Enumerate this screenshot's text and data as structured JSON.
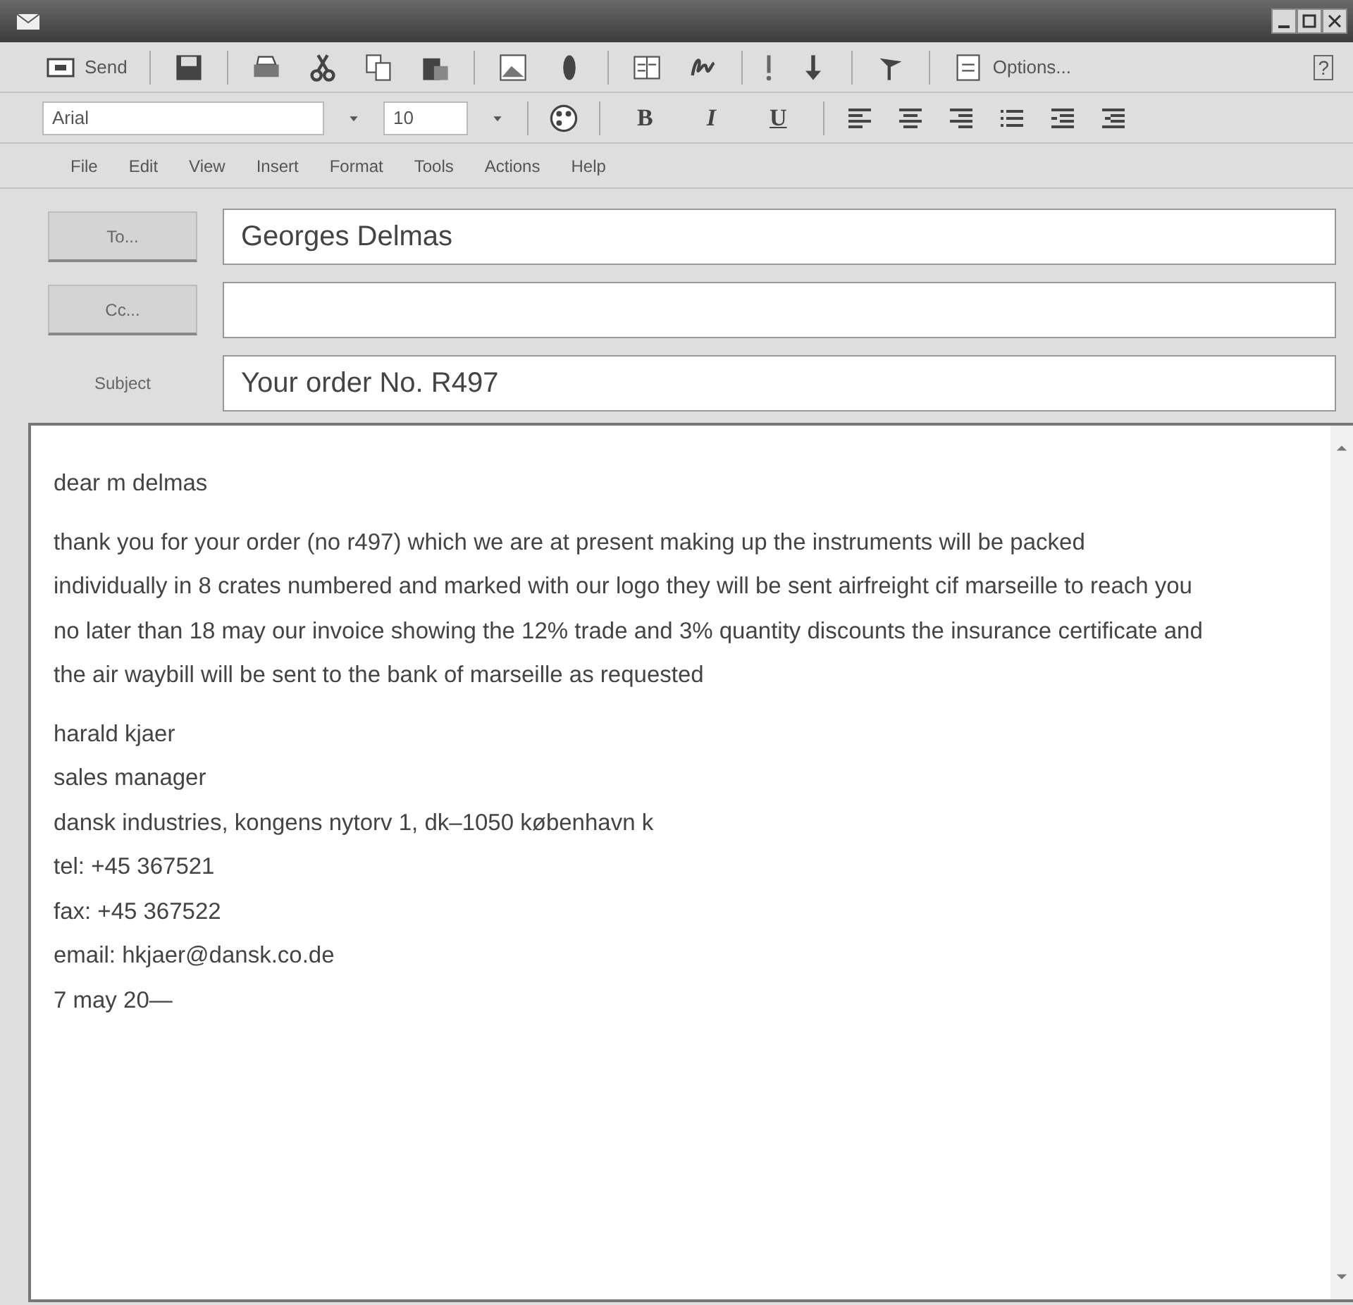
{
  "toolbar": {
    "send_label": "Send",
    "options_label": "Options...",
    "help_label": "?"
  },
  "format_bar": {
    "font": "Arial",
    "size": "10",
    "bold": "B",
    "italic": "I",
    "underline": "U"
  },
  "menu": [
    "File",
    "Edit",
    "View",
    "Insert",
    "Format",
    "Tools",
    "Actions",
    "Help"
  ],
  "fields": [
    {
      "kind": "button",
      "label": "To...",
      "value": "Georges Delmas"
    },
    {
      "kind": "button",
      "label": "Cc..."
    },
    {
      "kind": "label",
      "label": "Subject",
      "value": "Your order No. R497"
    }
  ],
  "body": {
    "greeting": "dear m delmas",
    "paragraphs": [
      "thank you for your order (no r497) which we are at present making up the instruments will be packed individually in 8 crates numbered and marked with our logo they will be sent airfreight cif marseille to reach you no later than 18 may our invoice showing the 12% trade and 3% quantity discounts the insurance certificate and the air waybill will be sent to the bank of marseille as requested"
    ],
    "signature": [
      "harald kjaer",
      "sales manager",
      "dansk industries, kongens nytorv 1, dk–1050 københavn k",
      "tel: +45 367521",
      "fax: +45 367522",
      "email: hkjaer@dansk.co.de",
      "7 may 20—"
    ]
  }
}
